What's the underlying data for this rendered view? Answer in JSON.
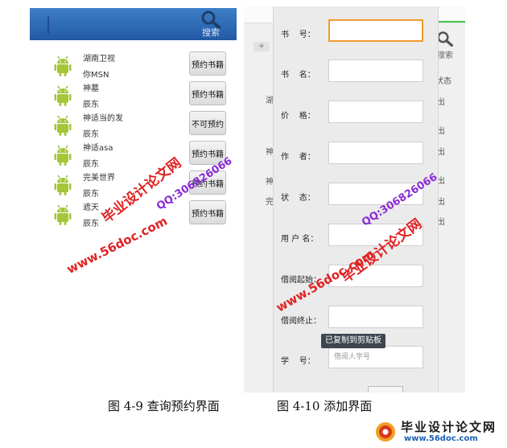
{
  "left_screen": {
    "search_label": "搜索",
    "items": [
      {
        "title": "湖南卫视",
        "subtitle": "你MSN",
        "action": "预约书籍"
      },
      {
        "title": "神墓",
        "subtitle": "辰东",
        "action": "预约书籍"
      },
      {
        "title": "神适当的发",
        "subtitle": "辰东",
        "action": "不可预约"
      },
      {
        "title": "神适asa",
        "subtitle": "辰东",
        "action": "预约书籍"
      },
      {
        "title": "完美世界",
        "subtitle": "辰东",
        "action": "预约书籍"
      },
      {
        "title": "遮天",
        "subtitle": "辰东",
        "action": "预约书籍"
      }
    ]
  },
  "right_screen": {
    "bg_search_label": "搜索",
    "plus_label": "+",
    "peek_text": [
      "状态",
      "出",
      "出",
      "出",
      "出",
      "出",
      "出",
      "湖",
      "神",
      "神",
      "完"
    ],
    "fields": [
      {
        "label": "书    号：",
        "value": "",
        "placeholder": ""
      },
      {
        "label": "书    名：",
        "value": "",
        "placeholder": ""
      },
      {
        "label": "价    格：",
        "value": "",
        "placeholder": ""
      },
      {
        "label": "作    者：",
        "value": "",
        "placeholder": ""
      },
      {
        "label": "状    态：",
        "value": "",
        "placeholder": ""
      },
      {
        "label": "用 户 名：",
        "value": "",
        "placeholder": ""
      },
      {
        "label": "借阅起始：",
        "value": "",
        "placeholder": ""
      },
      {
        "label": "借阅终止：",
        "value": "",
        "placeholder": ""
      },
      {
        "label": "学    号：",
        "value": "",
        "placeholder": "借阅人学号"
      }
    ],
    "toast": "已复制到剪贴板"
  },
  "captions": {
    "left": "图 4-9 查询预约界面",
    "right": "图 4-10 添加界面"
  },
  "watermarks": {
    "site_name": "毕业设计论文网",
    "url": "www.56doc.com",
    "qq": "QQ:306826066"
  },
  "logo": {
    "name": "毕业设计论文网",
    "url": "www.56doc.com"
  },
  "colors": {
    "topbar": "#2d6cb8",
    "focus_border": "#f29a2e",
    "watermark_red": "#e02222",
    "watermark_purple": "#8a2bd6",
    "droid_green": "#a4c639"
  }
}
